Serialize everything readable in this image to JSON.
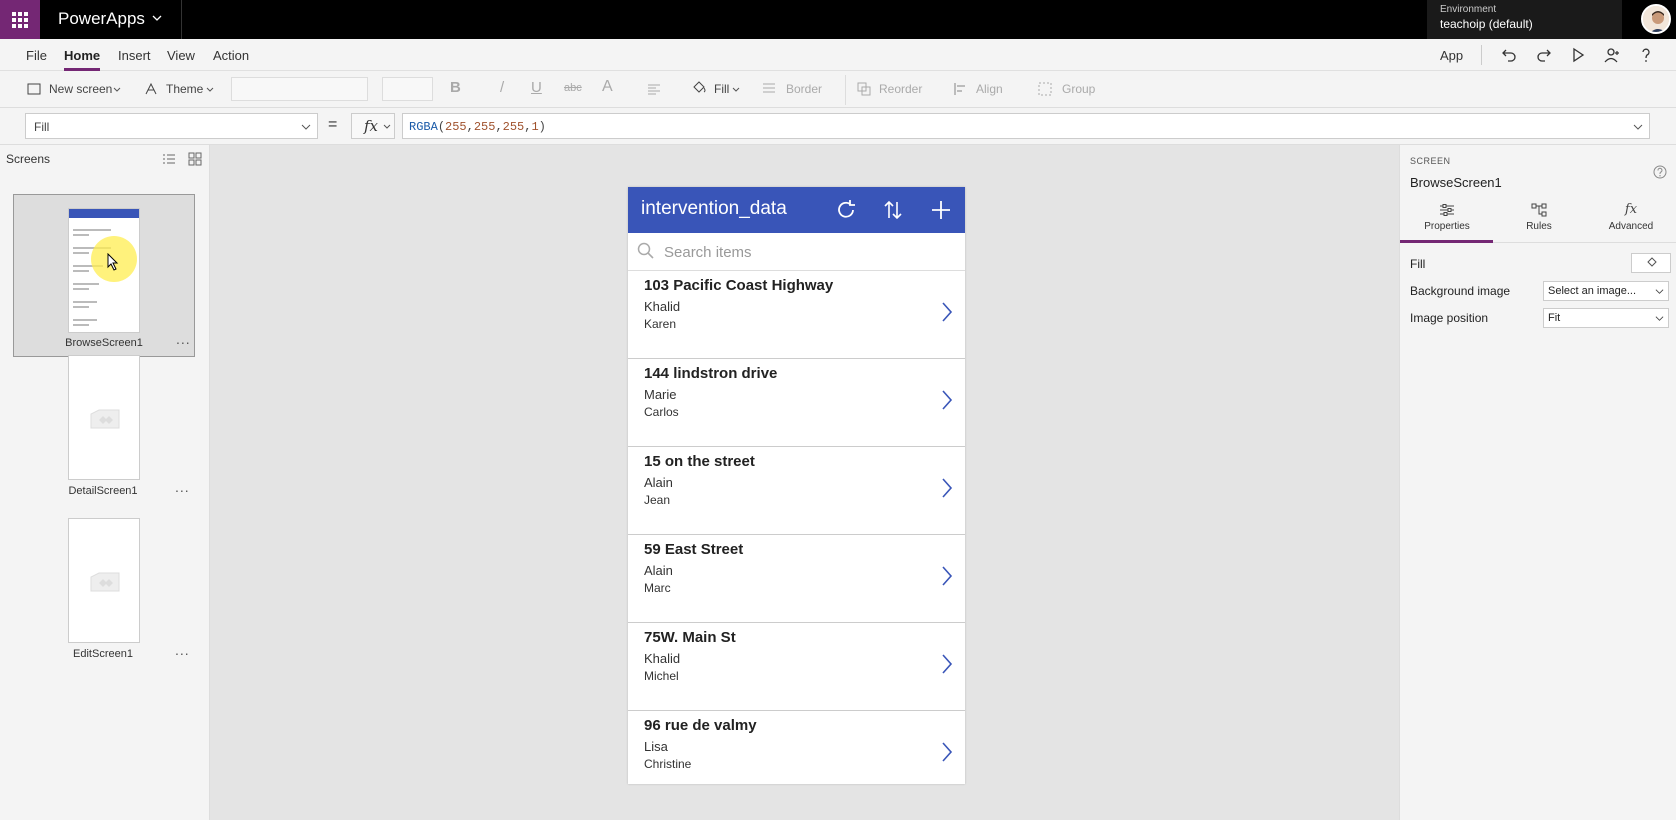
{
  "topbar": {
    "app_name": "PowerApps",
    "environment_label": "Environment",
    "environment_value": "teachoip (default)"
  },
  "menu": {
    "items": [
      "File",
      "Home",
      "Insert",
      "View",
      "Action"
    ],
    "active": "Home",
    "app_label": "App"
  },
  "ribbon": {
    "new_screen": "New screen",
    "theme": "Theme",
    "bold": "B",
    "italic": "/",
    "underline": "U",
    "strike": "abc",
    "font_color": "A",
    "fill": "Fill",
    "border": "Border",
    "reorder": "Reorder",
    "align": "Align",
    "group": "Group"
  },
  "formula": {
    "property": "Fill",
    "equals": "=",
    "fx": "fx",
    "fn": "RGBA",
    "open": "(",
    "args": [
      "255",
      "255",
      "255",
      "1"
    ],
    "close": ")"
  },
  "screens_pane": {
    "title": "Screens",
    "screens": [
      {
        "name": "BrowseScreen1",
        "selected": true
      },
      {
        "name": "DetailScreen1",
        "selected": false
      },
      {
        "name": "EditScreen1",
        "selected": false
      }
    ],
    "more": "..."
  },
  "app": {
    "title": "intervention_data",
    "search_placeholder": "Search items",
    "header_color": "#3955b8",
    "items": [
      {
        "title": "103 Pacific Coast Highway",
        "sub1": "Khalid",
        "sub2": "Karen"
      },
      {
        "title": "144 lindstron drive",
        "sub1": "Marie",
        "sub2": "Carlos"
      },
      {
        "title": "15 on the street",
        "sub1": "Alain",
        "sub2": "Jean"
      },
      {
        "title": "59 East Street",
        "sub1": "Alain",
        "sub2": "Marc"
      },
      {
        "title": "75W. Main St",
        "sub1": "Khalid",
        "sub2": "Michel"
      },
      {
        "title": "96 rue de valmy",
        "sub1": "Lisa",
        "sub2": "Christine"
      }
    ]
  },
  "props_pane": {
    "kind": "SCREEN",
    "name": "BrowseScreen1",
    "tabs": [
      "Properties",
      "Rules",
      "Advanced"
    ],
    "fill_label": "Fill",
    "background_image_label": "Background image",
    "background_image_value": "Select an image...",
    "image_position_label": "Image position",
    "image_position_value": "Fit"
  },
  "colors": {
    "accent": "#742774",
    "app_header": "#3955b8",
    "chevron": "#3955b8"
  }
}
